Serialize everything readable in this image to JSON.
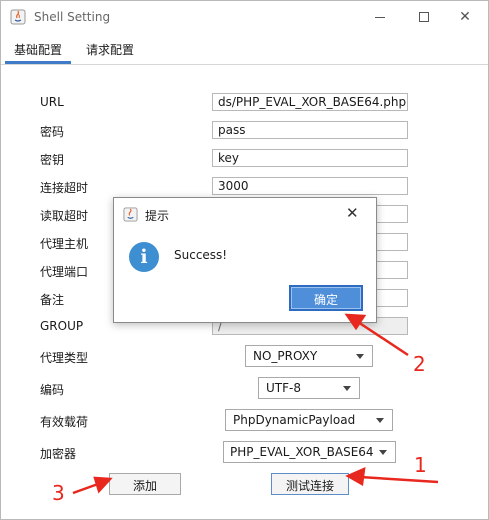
{
  "window": {
    "title": "Shell Setting"
  },
  "tabs": [
    {
      "label": "基础配置",
      "active": true
    },
    {
      "label": "请求配置",
      "active": false
    }
  ],
  "form": {
    "url": {
      "label": "URL",
      "value": "ds/PHP_EVAL_XOR_BASE64.php"
    },
    "password": {
      "label": "密码",
      "value": "pass"
    },
    "secret_key": {
      "label": "密钥",
      "value": "key"
    },
    "connect_timeout": {
      "label": "连接超时",
      "value": "3000"
    },
    "read_timeout": {
      "label": "读取超时",
      "value": ""
    },
    "proxy_host": {
      "label": "代理主机",
      "value": ""
    },
    "proxy_port": {
      "label": "代理端口",
      "value": ""
    },
    "remark": {
      "label": "备注",
      "value": ""
    },
    "group": {
      "label": "GROUP",
      "value": "/"
    },
    "proxy_type": {
      "label": "代理类型",
      "value": "NO_PROXY"
    },
    "encoding": {
      "label": "编码",
      "value": "UTF-8"
    },
    "payload": {
      "label": "有效载荷",
      "value": "PhpDynamicPayload"
    },
    "cryption": {
      "label": "加密器",
      "value": "PHP_EVAL_XOR_BASE64"
    }
  },
  "buttons": {
    "add": "添加",
    "test_connection": "测试连接"
  },
  "dialog": {
    "title": "提示",
    "message": "Success!",
    "ok_label": "确定"
  },
  "annotations": {
    "n1": "1",
    "n2": "2",
    "n3": "3",
    "color": "#e8281e"
  },
  "colors": {
    "accent": "#3f7bc7",
    "info": "#3d8fd1",
    "ok_button": "#4f8fd9"
  }
}
